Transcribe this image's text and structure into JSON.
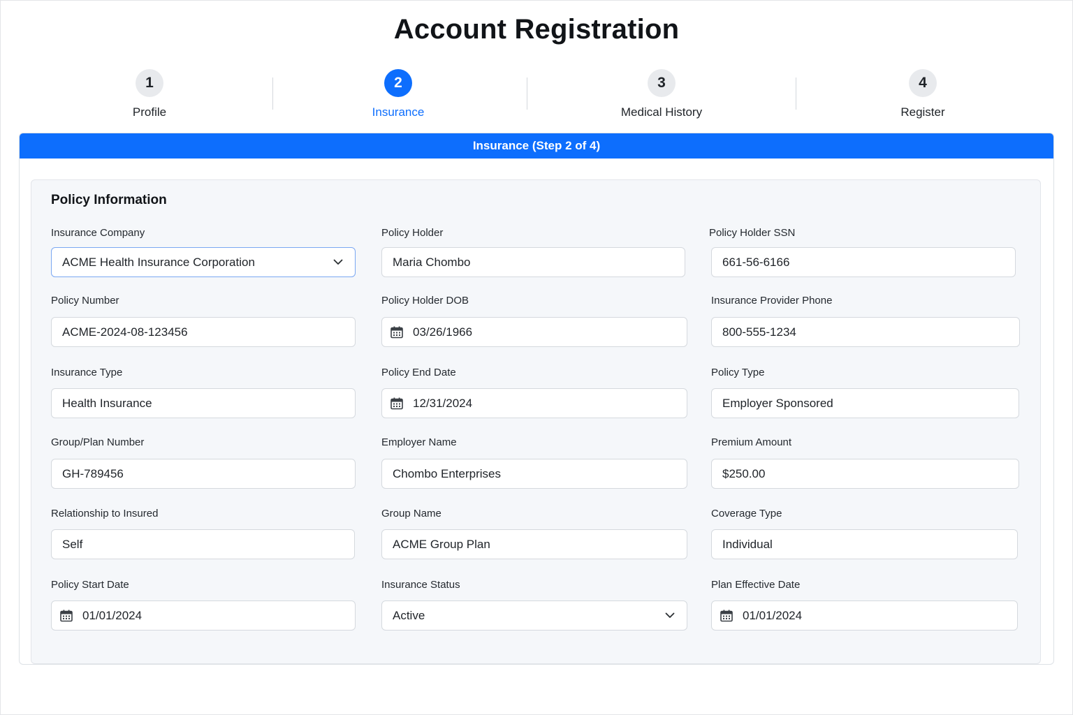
{
  "page": {
    "title": "Account Registration"
  },
  "steps": [
    {
      "number": "1",
      "label": "Profile"
    },
    {
      "number": "2",
      "label": "Insurance"
    },
    {
      "number": "3",
      "label": "Medical History"
    },
    {
      "number": "4",
      "label": "Register"
    }
  ],
  "banner": {
    "text": "Insurance (Step 2 of 4)"
  },
  "colors": {
    "accent": "#0d6efd",
    "step_inactive": "#e8eaed",
    "panel_bg": "#f5f7fa"
  },
  "section": {
    "title": "Policy Information"
  },
  "fields": {
    "insurance_company": {
      "label": "Insurance Company",
      "value": "ACME Health Insurance Corporation",
      "icon": "chevron-down-icon"
    },
    "policy_holder": {
      "label": "Policy Holder",
      "value": "Maria Chombo"
    },
    "policy_holder_ssn": {
      "label": "Policy Holder SSN",
      "value": "661-56-6166"
    },
    "policy_number": {
      "label": "Policy Number",
      "value": "ACME-2024-08-123456"
    },
    "policy_holder_dob": {
      "label": "Policy Holder DOB",
      "value": "03/26/1966",
      "icon": "calendar-icon"
    },
    "insurance_provider_phone": {
      "label": "Insurance Provider Phone",
      "value": "800-555-1234"
    },
    "insurance_type": {
      "label": "Insurance Type",
      "value": "Health Insurance"
    },
    "policy_end_date": {
      "label": "Policy End Date",
      "value": "12/31/2024",
      "icon": "calendar-icon"
    },
    "policy_type": {
      "label": "Policy Type",
      "value": "Employer Sponsored"
    },
    "group_plan_number": {
      "label": "Group/Plan Number",
      "value": "GH-789456"
    },
    "employer_name": {
      "label": "Employer Name",
      "value": "Chombo Enterprises"
    },
    "premium_amount": {
      "label": "Premium Amount",
      "value": "$250.00"
    },
    "relationship_to_insured": {
      "label": "Relationship to Insured",
      "value": "Self"
    },
    "group_name": {
      "label": "Group Name",
      "value": "ACME Group Plan"
    },
    "coverage_type": {
      "label": "Coverage Type",
      "value": "Individual"
    },
    "policy_start_date": {
      "label": "Policy Start Date",
      "value": "01/01/2024",
      "icon": "calendar-icon"
    },
    "insurance_status": {
      "label": "Insurance Status",
      "value": "Active",
      "icon": "chevron-down-icon"
    },
    "plan_effective_date": {
      "label": "Plan Effective Date",
      "value": "01/01/2024",
      "icon": "calendar-icon"
    }
  }
}
